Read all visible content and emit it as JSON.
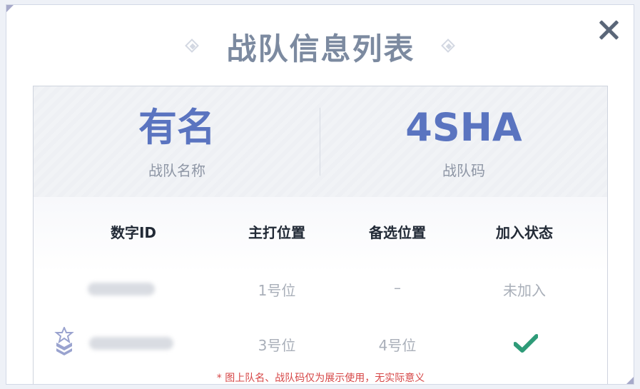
{
  "dialog": {
    "title": "战队信息列表"
  },
  "team": {
    "name": "有名",
    "name_label": "战队名称",
    "code": "4SHA",
    "code_label": "战队码"
  },
  "table": {
    "headers": [
      "数字ID",
      "主打位置",
      "备选位置",
      "加入状态"
    ],
    "rows": [
      {
        "id": "",
        "primary": "1号位",
        "secondary": "–",
        "status": "未加入"
      },
      {
        "id": "",
        "primary": "3号位",
        "secondary": "4号位",
        "status": ""
      }
    ]
  },
  "footer": {
    "note": "* 图上队名、战队码仅为展示使用，无实际意义"
  },
  "colors": {
    "accent": "#5a74c0",
    "check": "#2e9b78",
    "note": "#d64545"
  },
  "icons": {
    "close": "close-icon",
    "rank": "rank-badge-icon",
    "joined": "check-icon"
  }
}
